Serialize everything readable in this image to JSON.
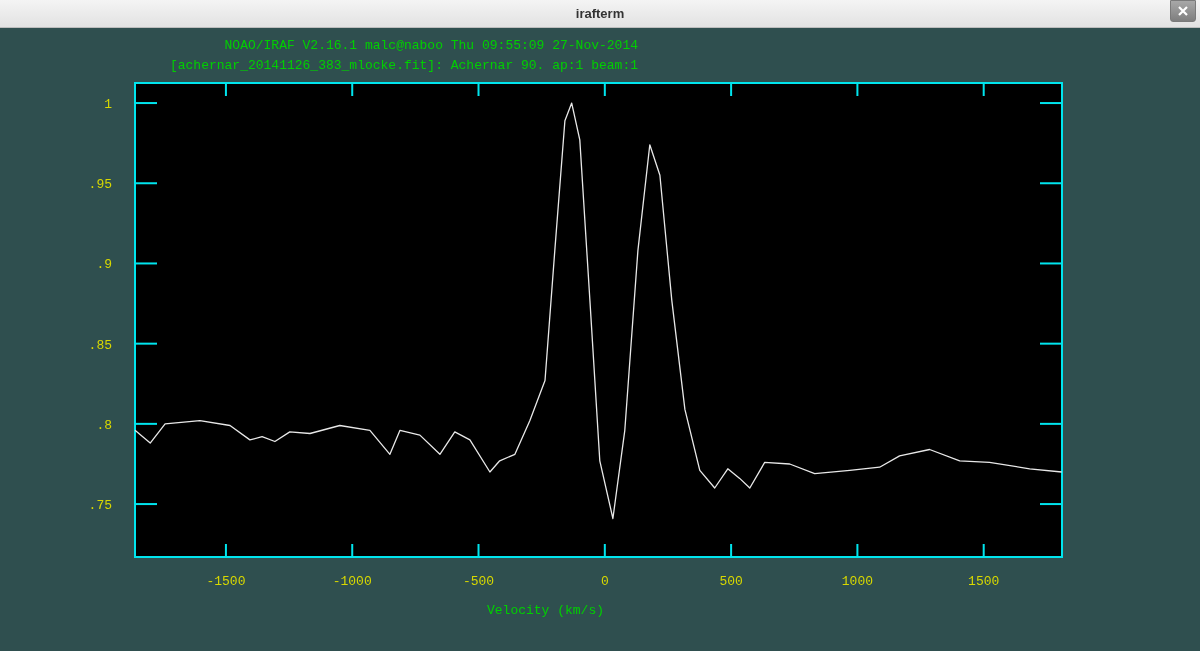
{
  "window": {
    "title": "irafterm"
  },
  "header": [
    "NOAO/IRAF V2.16.1 malc@naboo Thu 09:55:09 27-Nov-2014",
    "[achernar_20141126_383_mlocke.fit]: Achernar 90. ap:1 beam:1"
  ],
  "plot": {
    "chart_data": {
      "type": "line",
      "xlabel": "Velocity (km/s)",
      "xlim": [
        -1860,
        1810
      ],
      "ylim": [
        0.717,
        1.0125
      ],
      "xticks": [
        -1500,
        -1000,
        -500,
        0,
        500,
        1000,
        1500
      ],
      "yticks": [
        {
          "value": 0.75,
          "label": ".75"
        },
        {
          "value": 0.8,
          "label": ".8"
        },
        {
          "value": 0.85,
          "label": ".85"
        },
        {
          "value": 0.9,
          "label": ".9"
        },
        {
          "value": 0.95,
          "label": ".95"
        },
        {
          "value": 1,
          "label": "1"
        }
      ],
      "x": [
        -1860,
        -1800,
        -1741,
        -1603,
        -1484,
        -1405,
        -1357,
        -1306,
        -1247,
        -1167,
        -1049,
        -930,
        -851,
        -811,
        -732,
        -653,
        -594,
        -534,
        -455,
        -416,
        -356,
        -297,
        -237,
        -198,
        -158,
        -131,
        -99,
        -59,
        -20,
        32,
        79,
        131,
        178,
        218,
        265,
        317,
        376,
        435,
        487,
        534,
        574,
        633,
        732,
        831,
        970,
        1088,
        1167,
        1286,
        1405,
        1523,
        1682,
        1809
      ],
      "series": [
        {
          "color": "#e8e8e8",
          "values": [
            0.796,
            0.788,
            0.8,
            0.802,
            0.799,
            0.79,
            0.792,
            0.789,
            0.795,
            0.794,
            0.799,
            0.796,
            0.781,
            0.796,
            0.793,
            0.781,
            0.795,
            0.79,
            0.77,
            0.777,
            0.781,
            0.802,
            0.827,
            0.908,
            0.989,
            1.0,
            0.977,
            0.877,
            0.777,
            0.741,
            0.796,
            0.908,
            0.974,
            0.955,
            0.877,
            0.809,
            0.771,
            0.76,
            0.772,
            0.766,
            0.76,
            0.776,
            0.775,
            0.769,
            0.771,
            0.773,
            0.78,
            0.784,
            0.777,
            0.776,
            0.772,
            0.77
          ]
        }
      ]
    }
  }
}
